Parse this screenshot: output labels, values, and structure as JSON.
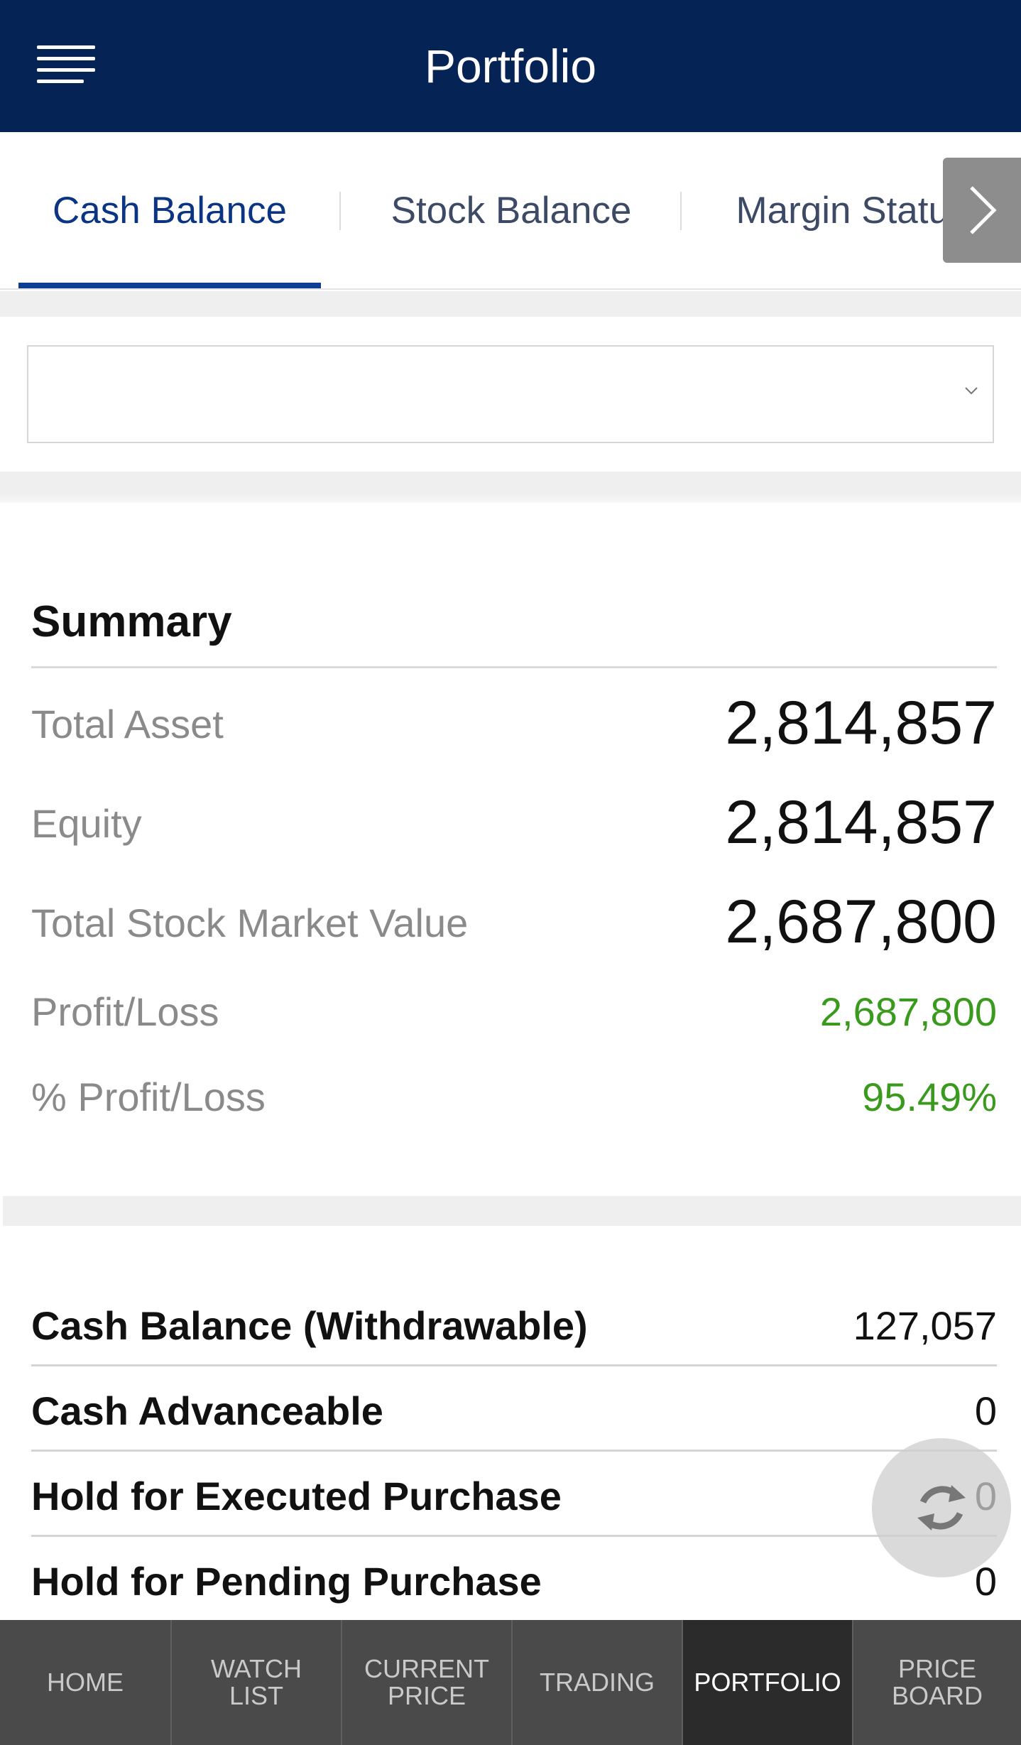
{
  "header": {
    "title": "Portfolio",
    "menu_icon": "hamburger-menu-icon"
  },
  "tabs": [
    {
      "label": "Cash Balance",
      "active": true
    },
    {
      "label": "Stock Balance",
      "active": false
    },
    {
      "label": "Margin Status",
      "active": false
    }
  ],
  "tab_next_icon": "chevron-right-icon",
  "account_select": {
    "value": "",
    "icon": "chevron-down-icon"
  },
  "summary": {
    "title": "Summary",
    "rows": [
      {
        "label": "Total Asset",
        "value": "2,814,857"
      },
      {
        "label": "Equity",
        "value": "2,814,857"
      },
      {
        "label": "Total Stock Market Value",
        "value": "2,687,800"
      },
      {
        "label": "Profit/Loss",
        "value": "2,687,800"
      },
      {
        "label": "% Profit/Loss",
        "value": "95.49%"
      }
    ]
  },
  "cash": {
    "rows": [
      {
        "label": "Cash Balance (Withdrawable)",
        "value": "127,057"
      },
      {
        "label": "Cash Advanceable",
        "value": "0"
      },
      {
        "label": "Hold for Executed Purchase",
        "value": "0"
      },
      {
        "label": "Hold for Pending Purchase",
        "value": "0"
      }
    ]
  },
  "refresh_icon": "refresh-icon",
  "colors": {
    "header_bg": "#052355",
    "active_tab": "#0b3583",
    "profit_green": "#3a9a1e",
    "nav_bg": "#4a4a4a"
  },
  "bottom_nav": [
    {
      "label": "HOME",
      "active": false
    },
    {
      "label": "WATCH\nLIST",
      "active": false
    },
    {
      "label": "CURRENT\nPRICE",
      "active": false
    },
    {
      "label": "TRADING",
      "active": false
    },
    {
      "label": "PORTFOLIO",
      "active": true
    },
    {
      "label": "PRICE\nBOARD",
      "active": false
    }
  ]
}
